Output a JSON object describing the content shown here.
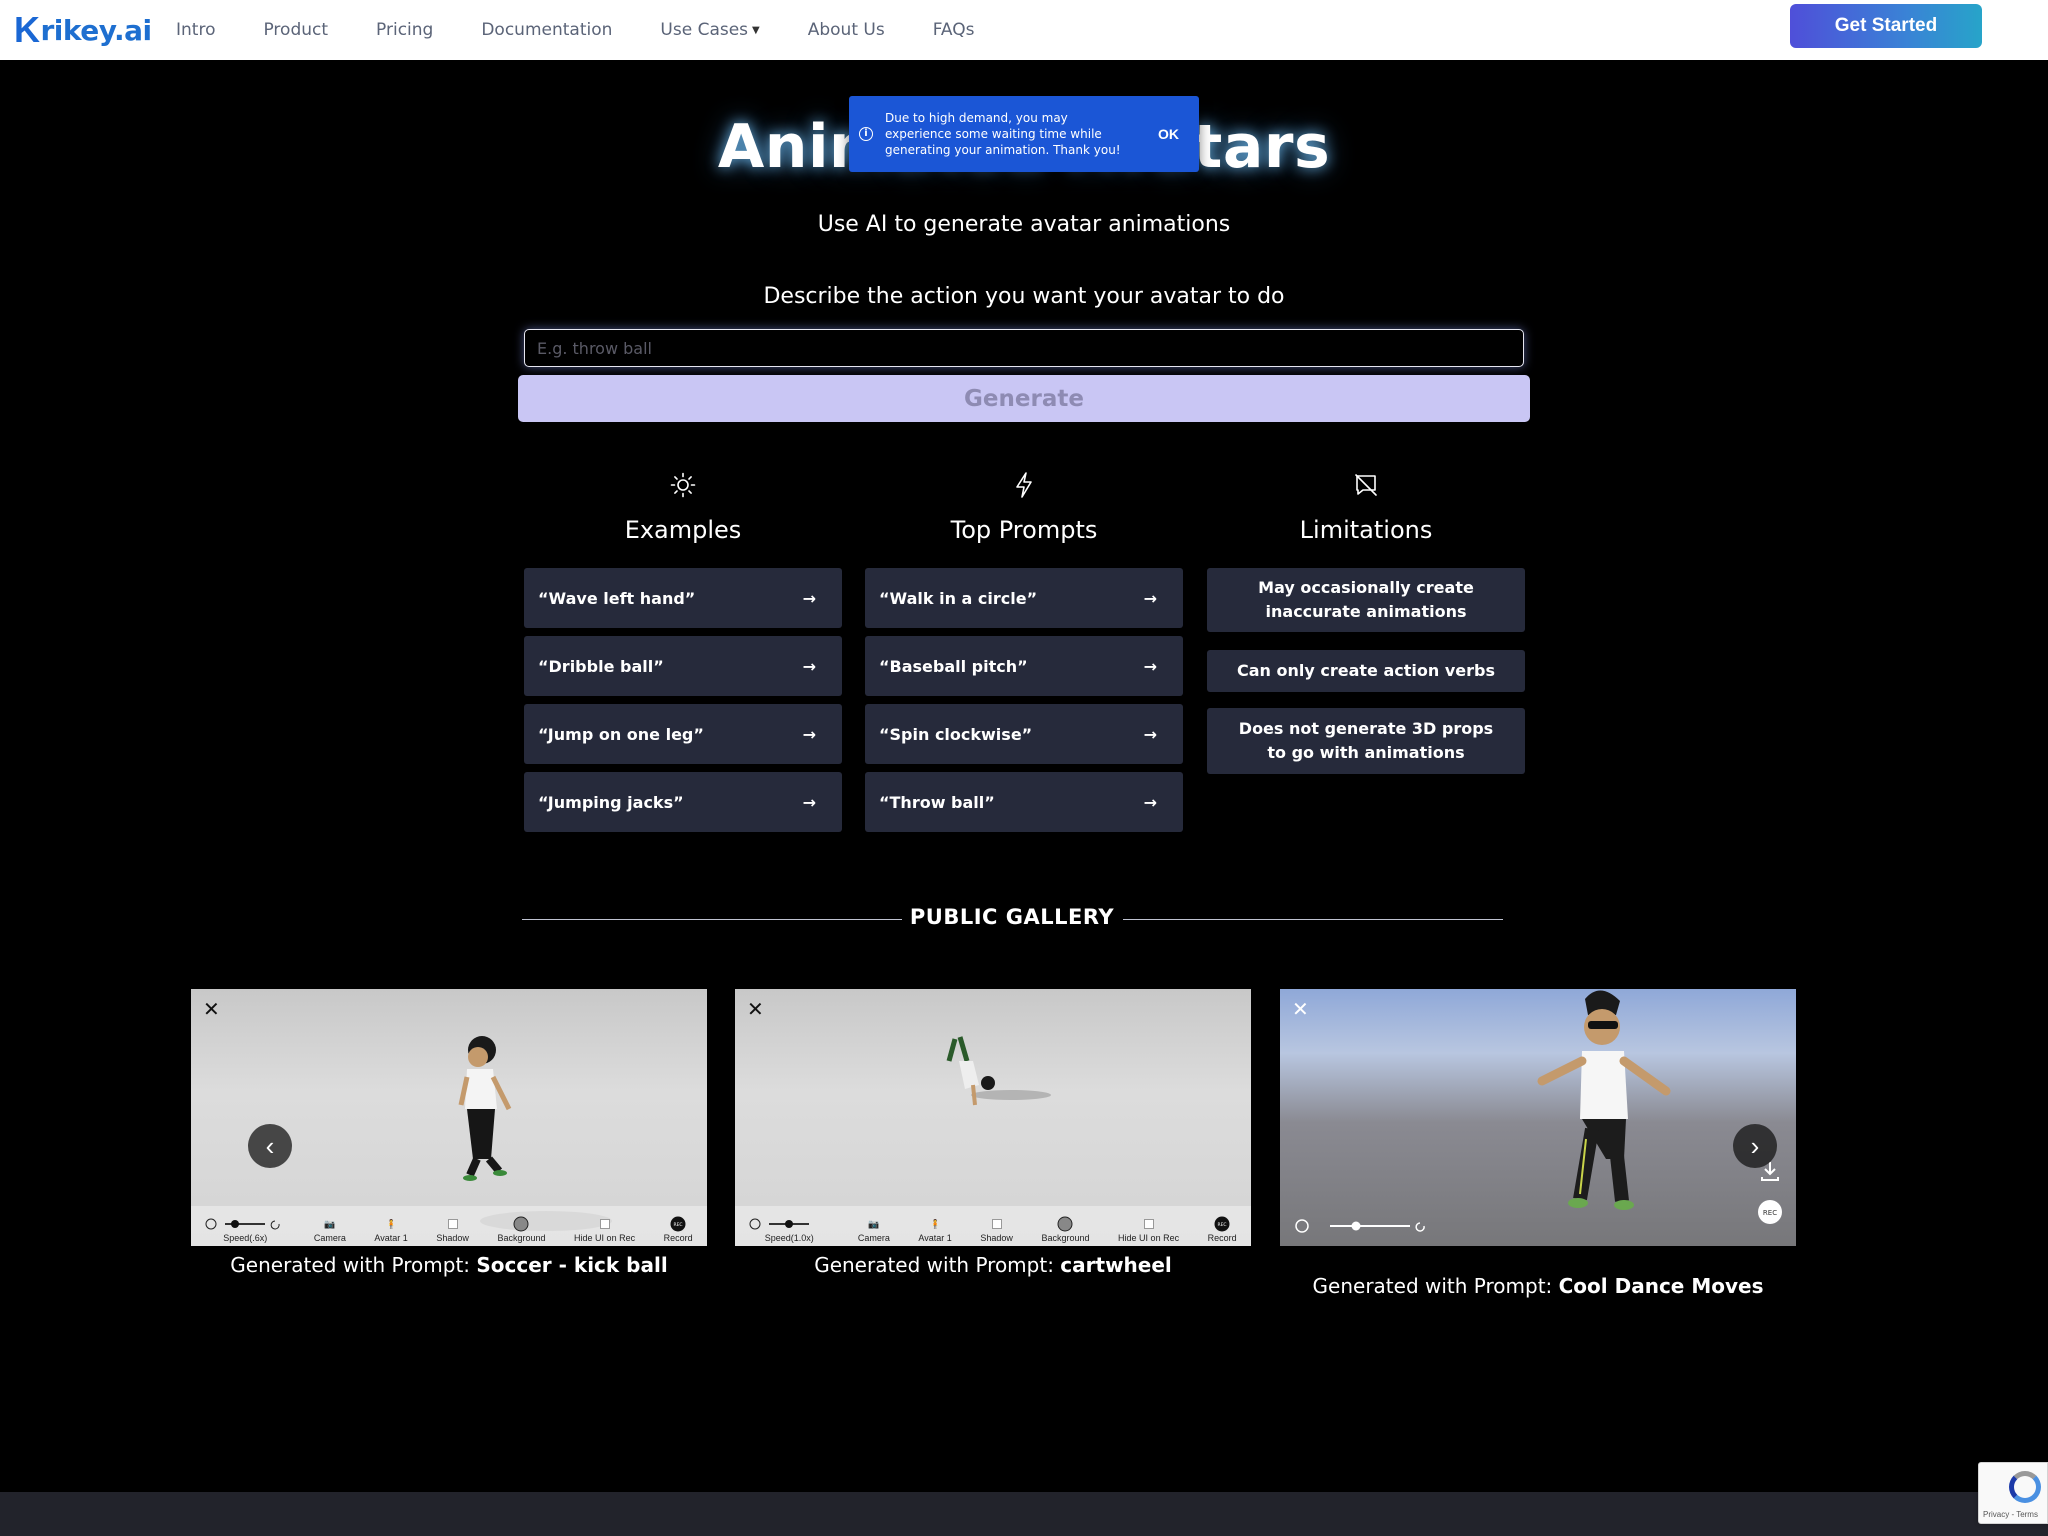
{
  "nav": {
    "logo_k": "K",
    "logo_rest": "rikey.ai",
    "links": [
      "Intro",
      "Product",
      "Pricing",
      "Documentation",
      "Use Cases",
      "About Us",
      "FAQs"
    ],
    "get_started": "Get Started"
  },
  "hero": {
    "title": "Animated Avatars",
    "subtitle": "Use AI to generate avatar animations",
    "describe": "Describe the action you want your avatar to do",
    "input_placeholder": "E.g. throw ball",
    "generate": "Generate"
  },
  "toast": {
    "message": "Due to high demand, you may experience some waiting time while generating your animation. Thank you!",
    "ok": "OK"
  },
  "columns": {
    "examples": {
      "title": "Examples",
      "items": [
        "“Wave left hand”",
        "“Dribble ball”",
        "“Jump on one leg”",
        "“Jumping jacks”"
      ]
    },
    "top_prompts": {
      "title": "Top Prompts",
      "items": [
        "“Walk in a circle”",
        "“Baseball pitch”",
        "“Spin clockwise”",
        "“Throw ball”"
      ]
    },
    "limitations": {
      "title": "Limitations",
      "items": [
        "May occasionally create inaccurate animations",
        "Can only create action verbs",
        "Does not generate 3D props to go with animations"
      ]
    }
  },
  "gallery": {
    "label": "PUBLIC GALLERY",
    "caption_prefix": "Generated with Prompt: ",
    "items": [
      {
        "prompt": "Soccer - kick ball",
        "speed": "Speed(.6x)"
      },
      {
        "prompt": "cartwheel",
        "speed": "Speed(1.0x)"
      },
      {
        "prompt": "Cool Dance Moves"
      }
    ],
    "toolbar": {
      "camera": "Camera",
      "avatar": "Avatar 1",
      "shadow": "Shadow",
      "background": "Background",
      "hide_ui": "Hide UI on Rec",
      "record": "Record",
      "rec": "REC"
    }
  },
  "recaptcha": {
    "text": "Privacy - Terms"
  }
}
